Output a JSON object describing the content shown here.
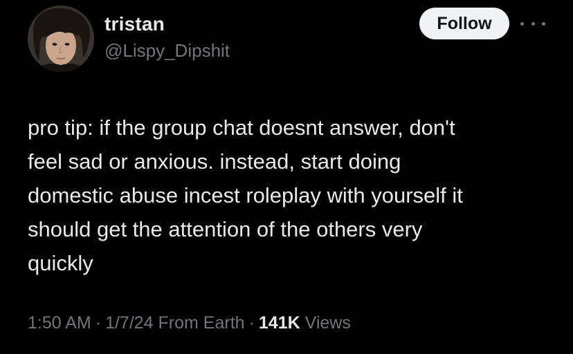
{
  "user": {
    "display_name": "tristan",
    "handle": "@Lispy_Dipshit"
  },
  "actions": {
    "follow_label": "Follow",
    "more_icon": "more-horizontal-icon"
  },
  "tweet": {
    "lines": [
      "pro tip: if the group chat doesnt answer, don't",
      "feel sad or anxious. instead, start doing",
      "domestic abuse incest roleplay with yourself it",
      "should get the attention of the others very",
      "quickly"
    ]
  },
  "meta": {
    "time": "1:50 AM",
    "separator": "·",
    "date": "1/7/24",
    "location": "From Earth",
    "views_count": "141K",
    "views_label": "Views"
  },
  "colors": {
    "background": "#000000",
    "primary_text": "#e7e9ea",
    "secondary_text": "#71767b",
    "follow_button_bg": "#eff3f4"
  }
}
